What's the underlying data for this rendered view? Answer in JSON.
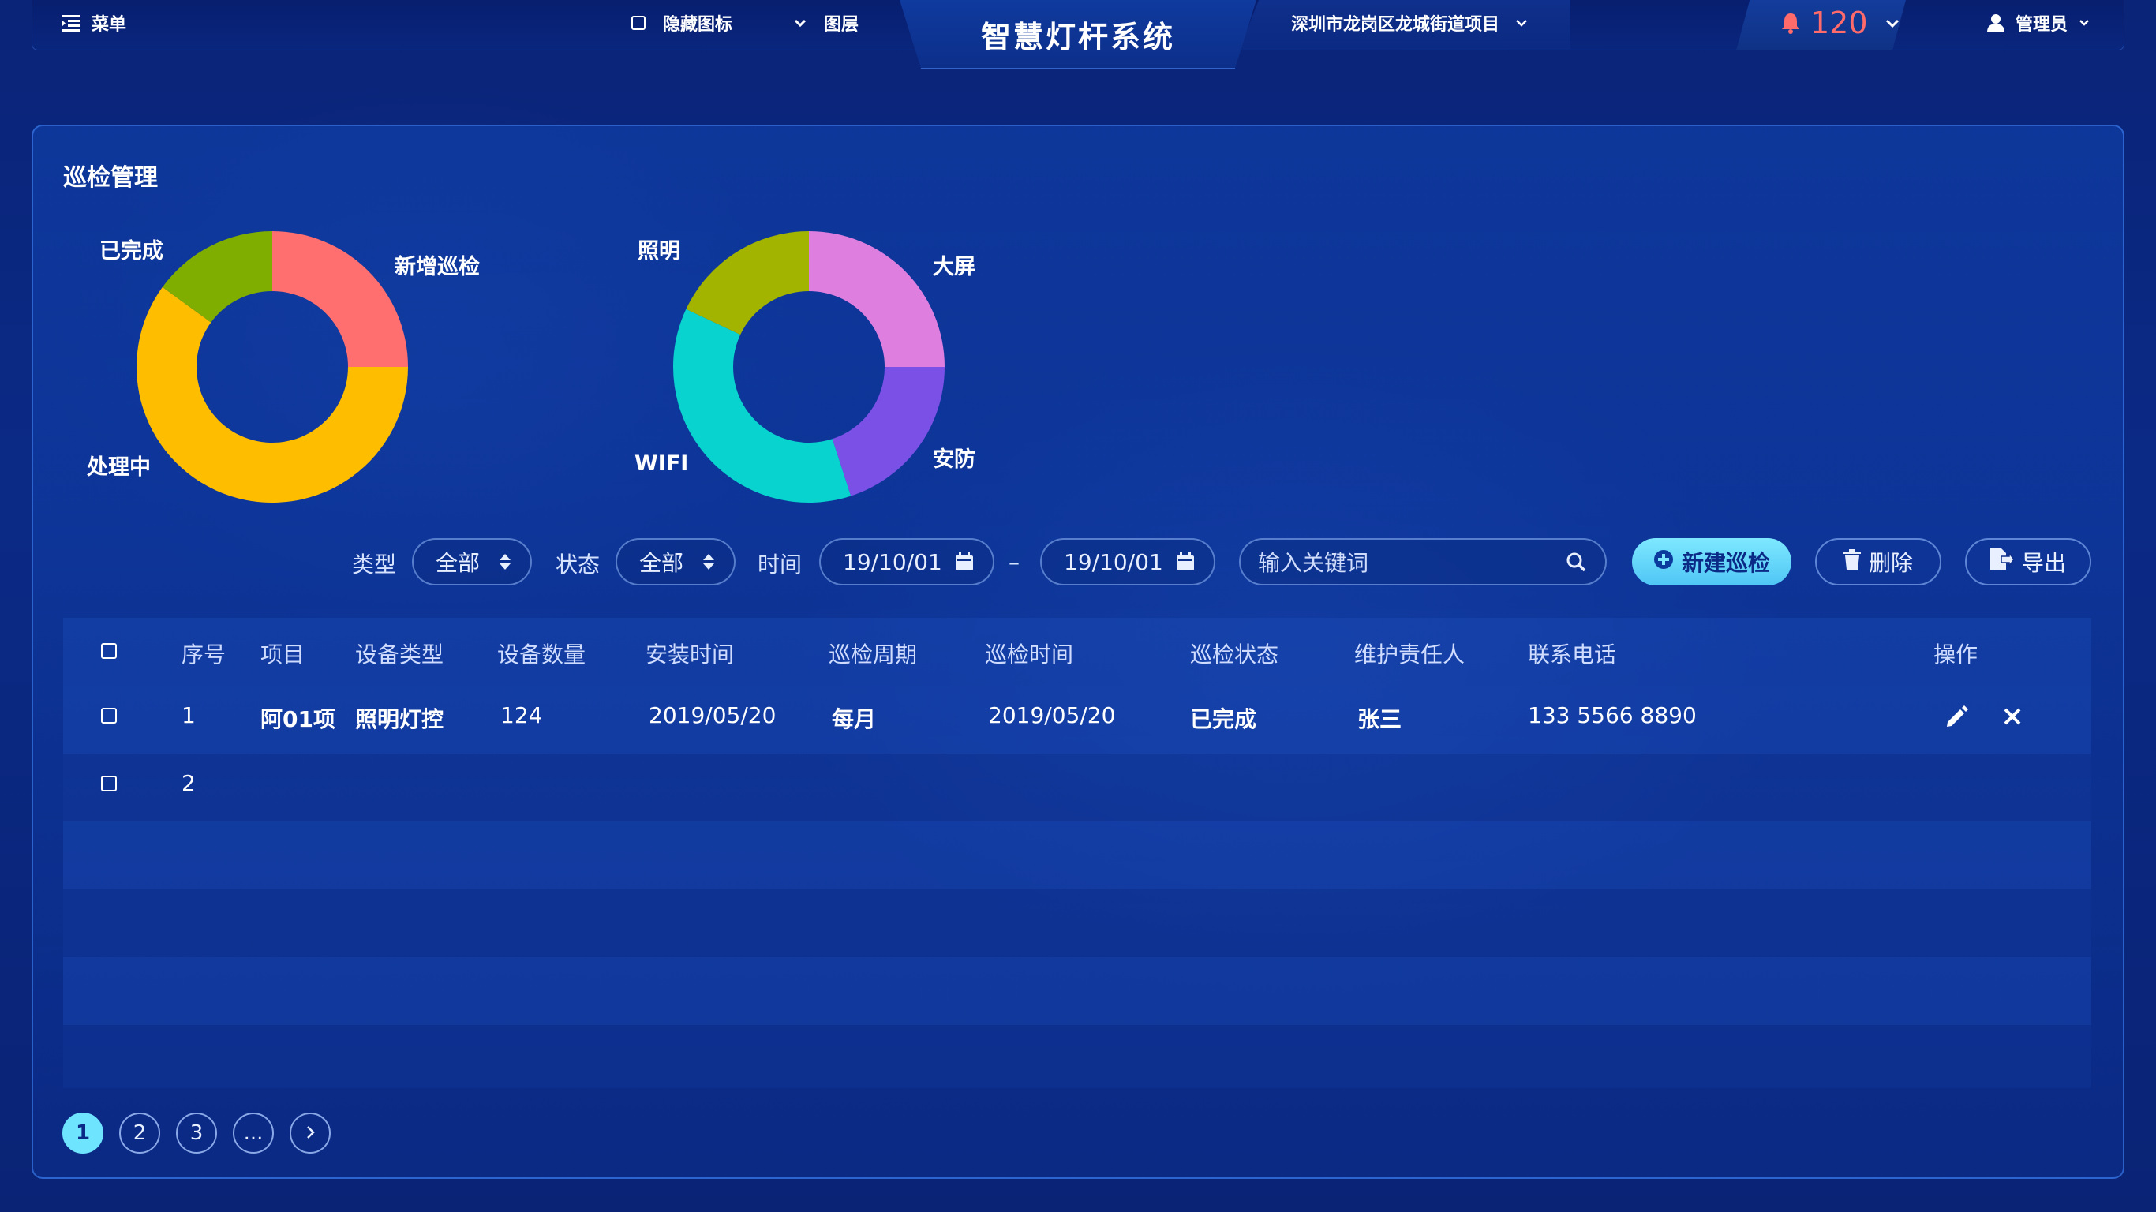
{
  "header": {
    "menu_label": "菜单",
    "hide_icons_label": "隐藏图标",
    "layers_label": "图层",
    "app_title": "智慧灯杆系统",
    "project_label": "深圳市龙岗区龙城街道项目",
    "alarm_count": "120",
    "user_label": "管理员"
  },
  "panel": {
    "title": "巡检管理"
  },
  "charts": {
    "status": {
      "labels": [
        "新增巡检",
        "已完成",
        "处理中"
      ],
      "colors": [
        "#ff6f6f",
        "#7fae00",
        "#ffbd00"
      ]
    },
    "type": {
      "labels": [
        "大屏",
        "安防",
        "WIFI",
        "照明"
      ],
      "colors": [
        "#de7fe0",
        "#7a50e6",
        "#08d3cf",
        "#a2b400"
      ]
    }
  },
  "chart_data": [
    {
      "type": "pie",
      "categories": [
        "新增巡检",
        "处理中",
        "已完成"
      ],
      "values": [
        25,
        60,
        15
      ]
    },
    {
      "type": "pie",
      "categories": [
        "大屏",
        "安防",
        "WIFI",
        "照明"
      ],
      "values": [
        25,
        20,
        37,
        18
      ]
    }
  ],
  "filters": {
    "type_label": "类型",
    "type_value": "全部",
    "status_label": "状态",
    "status_value": "全部",
    "time_label": "时间",
    "date_from": "19/10/01",
    "date_sep": "–",
    "date_to": "19/10/01",
    "search_placeholder": "输入关键词",
    "new_label": "新建巡检",
    "delete_label": "删除",
    "export_label": "导出"
  },
  "table": {
    "headers": [
      "序号",
      "项目",
      "设备类型",
      "设备数量",
      "安装时间",
      "巡检周期",
      "巡检时间",
      "巡检状态",
      "维护责任人",
      "联系电话",
      "操作"
    ],
    "rows": [
      [
        "1",
        "阿01项",
        "照明灯控",
        "124",
        "2019/05/20",
        "每月",
        "2019/05/20",
        "已完成",
        "张三",
        "133 5566 8890"
      ],
      [
        "2",
        "",
        "",
        "",
        "",
        "",
        "",
        "",
        "",
        ""
      ]
    ]
  },
  "pagination": {
    "pages": [
      "1",
      "2",
      "3",
      "..."
    ],
    "current": "1"
  }
}
